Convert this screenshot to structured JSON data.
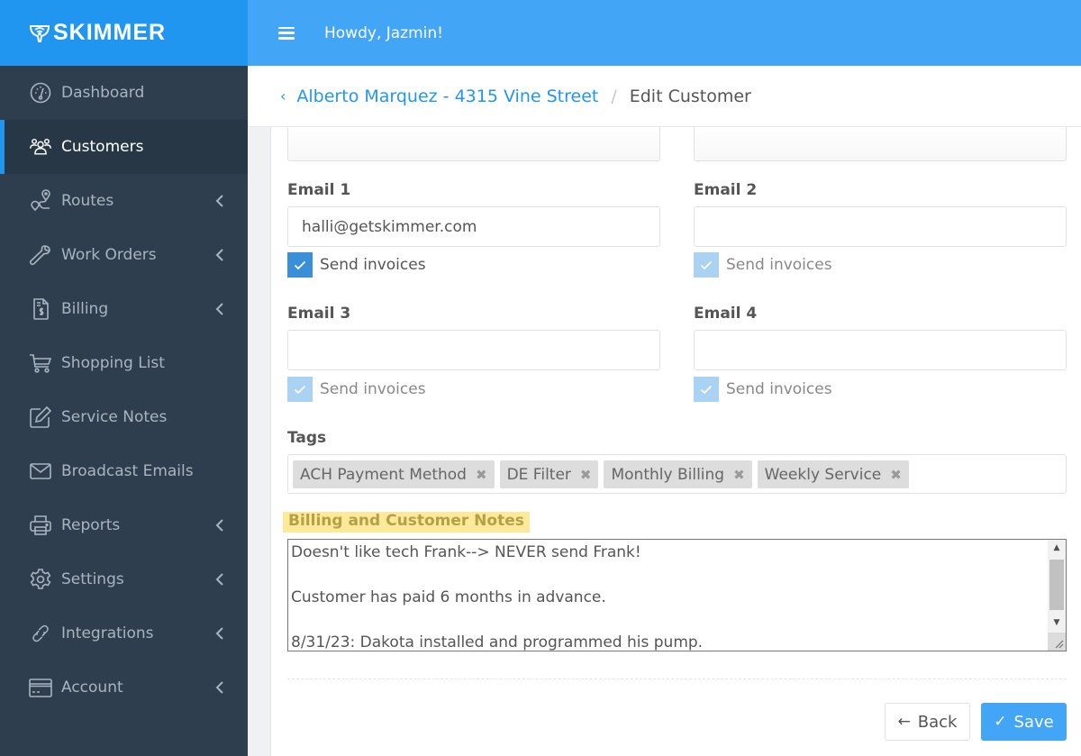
{
  "brand": {
    "name": "SKIMMER",
    "color": "#2196f0"
  },
  "topbar": {
    "greeting": "Howdy, Jazmin!",
    "menu_icon": "hamburger-icon"
  },
  "sidebar": {
    "items": [
      {
        "label": "Dashboard",
        "icon": "dashboard-gauge-icon",
        "active": false,
        "has_submenu": false
      },
      {
        "label": "Customers",
        "icon": "users-icon",
        "active": true,
        "has_submenu": false
      },
      {
        "label": "Routes",
        "icon": "route-icon",
        "active": false,
        "has_submenu": true
      },
      {
        "label": "Work Orders",
        "icon": "wrench-icon",
        "active": false,
        "has_submenu": true
      },
      {
        "label": "Billing",
        "icon": "invoice-icon",
        "active": false,
        "has_submenu": true
      },
      {
        "label": "Shopping List",
        "icon": "cart-icon",
        "active": false,
        "has_submenu": false
      },
      {
        "label": "Service Notes",
        "icon": "edit-note-icon",
        "active": false,
        "has_submenu": false
      },
      {
        "label": "Broadcast Emails",
        "icon": "envelope-icon",
        "active": false,
        "has_submenu": false
      },
      {
        "label": "Reports",
        "icon": "printer-icon",
        "active": false,
        "has_submenu": true
      },
      {
        "label": "Settings",
        "icon": "gear-icon",
        "active": false,
        "has_submenu": true
      },
      {
        "label": "Integrations",
        "icon": "link-icon",
        "active": false,
        "has_submenu": true
      },
      {
        "label": "Account",
        "icon": "credit-card-icon",
        "active": false,
        "has_submenu": true
      }
    ]
  },
  "breadcrumb": {
    "parent": "Alberto Marquez - 4315 Vine Street",
    "separator": "/",
    "current": "Edit Customer"
  },
  "form": {
    "emails": [
      {
        "label": "Email 1",
        "value": "halli@getskimmer.com",
        "send_invoices_label": "Send invoices",
        "send_invoices": true,
        "enabled": true
      },
      {
        "label": "Email 2",
        "value": "",
        "send_invoices_label": "Send invoices",
        "send_invoices": true,
        "enabled": false
      },
      {
        "label": "Email 3",
        "value": "",
        "send_invoices_label": "Send invoices",
        "send_invoices": true,
        "enabled": false
      },
      {
        "label": "Email 4",
        "value": "",
        "send_invoices_label": "Send invoices",
        "send_invoices": true,
        "enabled": false
      }
    ],
    "tags_label": "Tags",
    "tags": [
      "ACH Payment Method",
      "DE Filter",
      "Monthly Billing",
      "Weekly Service"
    ],
    "tag_remove_glyph": "✖",
    "notes_label": "Billing and Customer Notes",
    "notes_value": "Doesn't like tech Frank--> NEVER send Frank!\n\nCustomer has paid 6 months in advance.\n\n8/31/23: Dakota installed and programmed his pump.",
    "notes_highlight_color": "#fde99a"
  },
  "actions": {
    "back_label": "Back",
    "back_icon": "←",
    "save_label": "Save",
    "save_icon": "✓",
    "save_color": "#42a5f5"
  }
}
